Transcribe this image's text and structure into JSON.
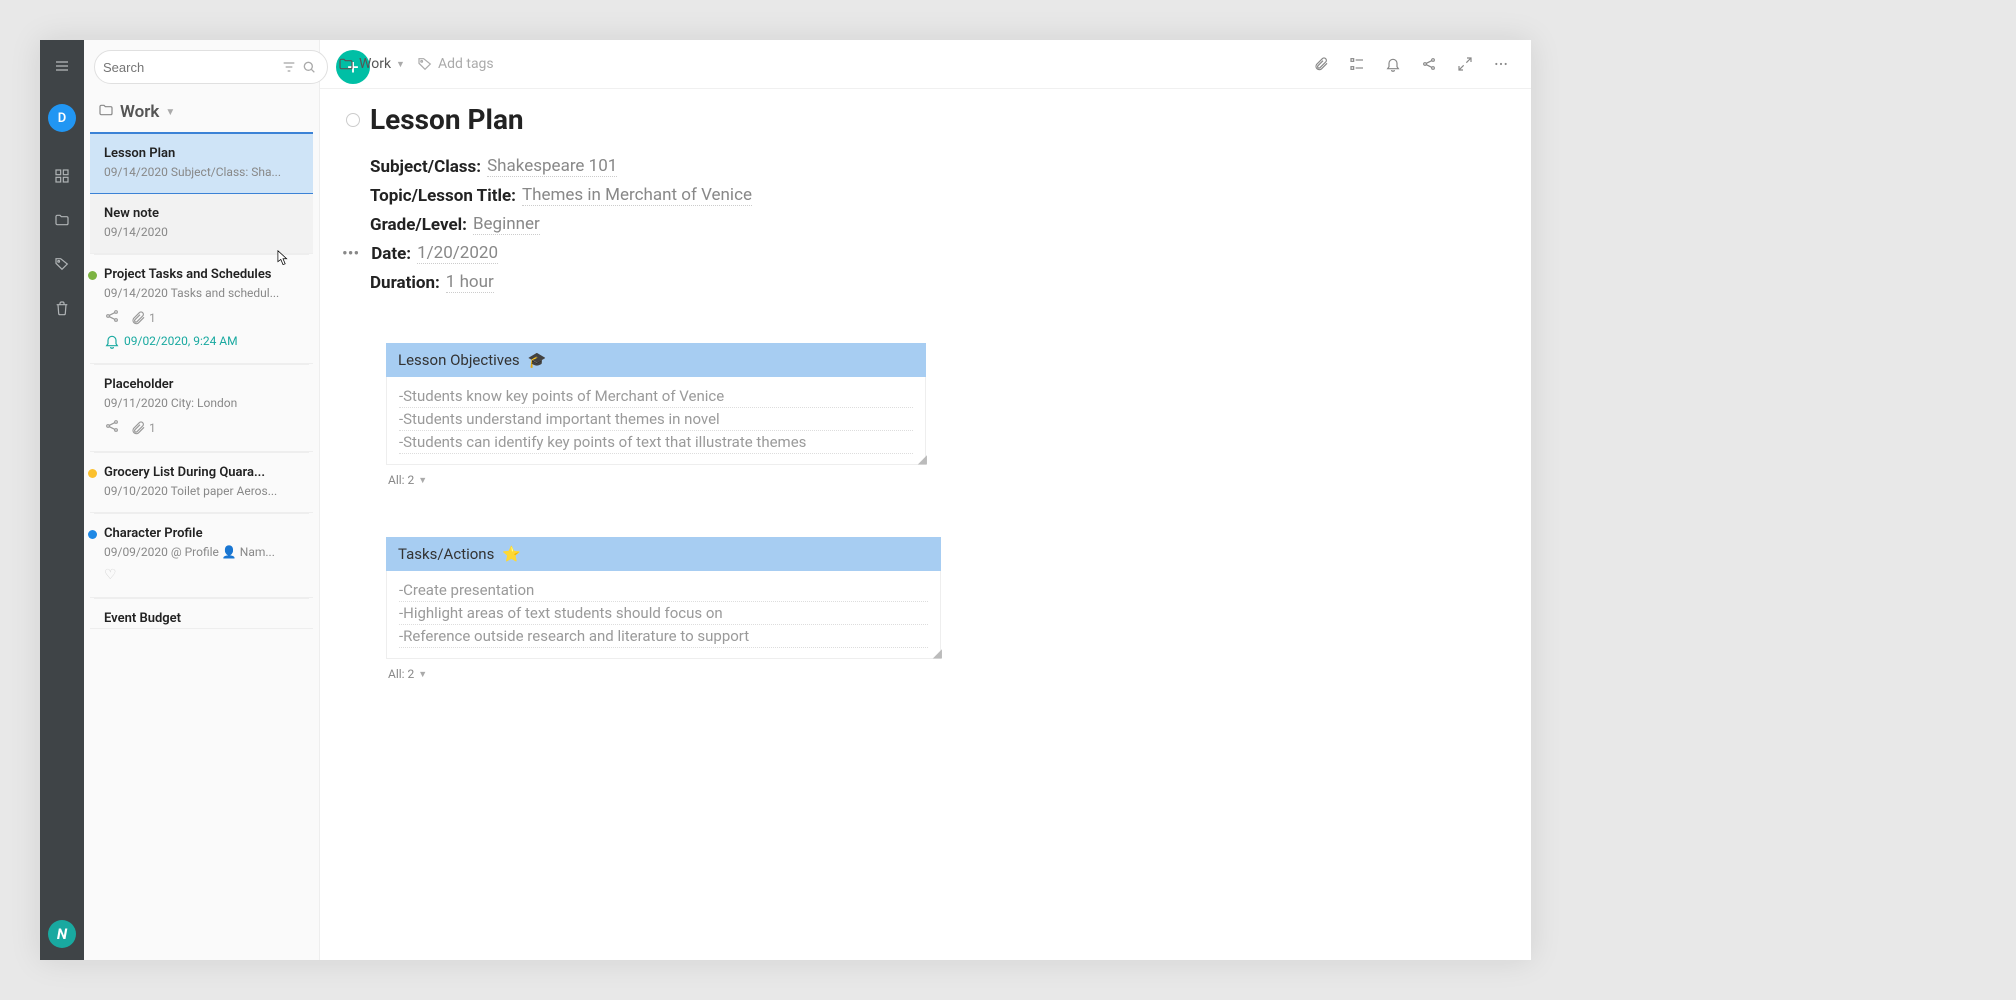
{
  "rail": {
    "avatar_letter": "D",
    "brand_letter": "N"
  },
  "search": {
    "placeholder": "Search"
  },
  "list": {
    "folder_label": "Work",
    "items": [
      {
        "title": "Lesson Plan",
        "meta": "09/14/2020 Subject/Class: Sha...",
        "dot": null
      },
      {
        "title": "New note",
        "meta": "09/14/2020",
        "dot": null
      },
      {
        "title": "Project Tasks and Schedules",
        "meta": "09/14/2020 Tasks and schedul...",
        "dot": "#7cb342",
        "attach_count": "1",
        "reminder": "09/02/2020, 9:24 AM"
      },
      {
        "title": "Placeholder",
        "meta": "09/11/2020 City: London",
        "dot": null,
        "attach_count": "1"
      },
      {
        "title": "Grocery List During Quara...",
        "meta": "09/10/2020 Toilet paper Aeros...",
        "dot": "#fbc02d"
      },
      {
        "title": "Character Profile",
        "meta": "09/09/2020 @ Profile 👤 Nam...",
        "dot": "#1e88e5",
        "heart": true
      },
      {
        "title": "Event Budget",
        "meta": "",
        "dot": null
      }
    ]
  },
  "toolbar": {
    "folder": "Work",
    "add_tags": "Add tags"
  },
  "editor": {
    "title": "Lesson Plan",
    "fields": {
      "subject_label": "Subject/Class:",
      "subject_val": "Shakespeare 101",
      "topic_label": "Topic/Lesson Title:",
      "topic_val": "Themes in Merchant of Venice",
      "grade_label": "Grade/Level:",
      "grade_val": "Beginner",
      "date_label": "Date:",
      "date_val": "1/20/2020",
      "duration_label": "Duration:",
      "duration_val": "1 hour"
    },
    "sections": [
      {
        "header": "Lesson Objectives",
        "icon": "🎓",
        "lines": [
          "-Students know key points of Merchant of Venice",
          "-Students understand important themes in novel",
          "-Students can identify key points of text that illustrate themes"
        ],
        "footer": "All: 2"
      },
      {
        "header": "Tasks/Actions",
        "icon": "⭐",
        "lines": [
          "-Create presentation",
          "-Highlight areas of text students should focus on",
          "-Reference outside research and literature to support"
        ],
        "footer": "All: 2"
      }
    ]
  }
}
